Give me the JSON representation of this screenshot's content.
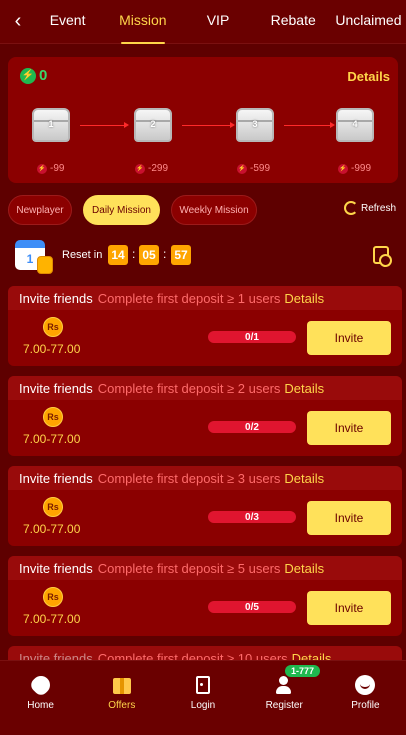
{
  "topnav": {
    "back_icon": "chevron-left-icon",
    "tabs": [
      "Event",
      "Mission",
      "VIP",
      "Rebate",
      "Unclaimed"
    ],
    "active_tab": "Mission"
  },
  "progress_card": {
    "coin_total": "0",
    "details_label": "Details",
    "chests": [
      {
        "label": "1",
        "threshold": "-99"
      },
      {
        "label": "2",
        "threshold": "-299"
      },
      {
        "label": "3",
        "threshold": "-599"
      },
      {
        "label": "4",
        "threshold": "-999"
      }
    ]
  },
  "filters": {
    "newplayer": "Newplayer",
    "daily": "Daily Mission",
    "weekly": "Weekly Mission",
    "active": "Daily Mission",
    "refresh": "Refresh"
  },
  "reset": {
    "label": "Reset in",
    "hours": "14",
    "minutes": "05",
    "seconds": "57",
    "calendar_day": "1"
  },
  "missions": [
    {
      "title": "Invite friends",
      "desc": "Complete first deposit ≥ 1 users",
      "details": "Details",
      "currency": "Rs",
      "reward": "7.00-77.00",
      "progress": "0/1",
      "button": "Invite"
    },
    {
      "title": "Invite friends",
      "desc": "Complete first deposit ≥ 2 users",
      "details": "Details",
      "currency": "Rs",
      "reward": "7.00-77.00",
      "progress": "0/2",
      "button": "Invite"
    },
    {
      "title": "Invite friends",
      "desc": "Complete first deposit ≥ 3 users",
      "details": "Details",
      "currency": "Rs",
      "reward": "7.00-77.00",
      "progress": "0/3",
      "button": "Invite"
    },
    {
      "title": "Invite friends",
      "desc": "Complete first deposit ≥ 5 users",
      "details": "Details",
      "currency": "Rs",
      "reward": "7.00-77.00",
      "progress": "0/5",
      "button": "Invite"
    },
    {
      "title": "Invite friends",
      "desc": "Complete first deposit ≥ 10 users",
      "details": "Details"
    }
  ],
  "bottomnav": {
    "items": [
      {
        "label": "Home",
        "icon": "spade-icon"
      },
      {
        "label": "Offers",
        "icon": "gift-icon"
      },
      {
        "label": "Login",
        "icon": "door-icon"
      },
      {
        "label": "Register",
        "icon": "add-user-icon"
      },
      {
        "label": "Profile",
        "icon": "profile-icon"
      }
    ],
    "active": "Offers",
    "register_badge": "1-777"
  },
  "colors": {
    "background": "#5e0000",
    "card": "#8b0000",
    "accent": "#ffd54a",
    "button": "#ffe15a",
    "progress": "#e0152f",
    "coin_green": "#3bd66a"
  }
}
